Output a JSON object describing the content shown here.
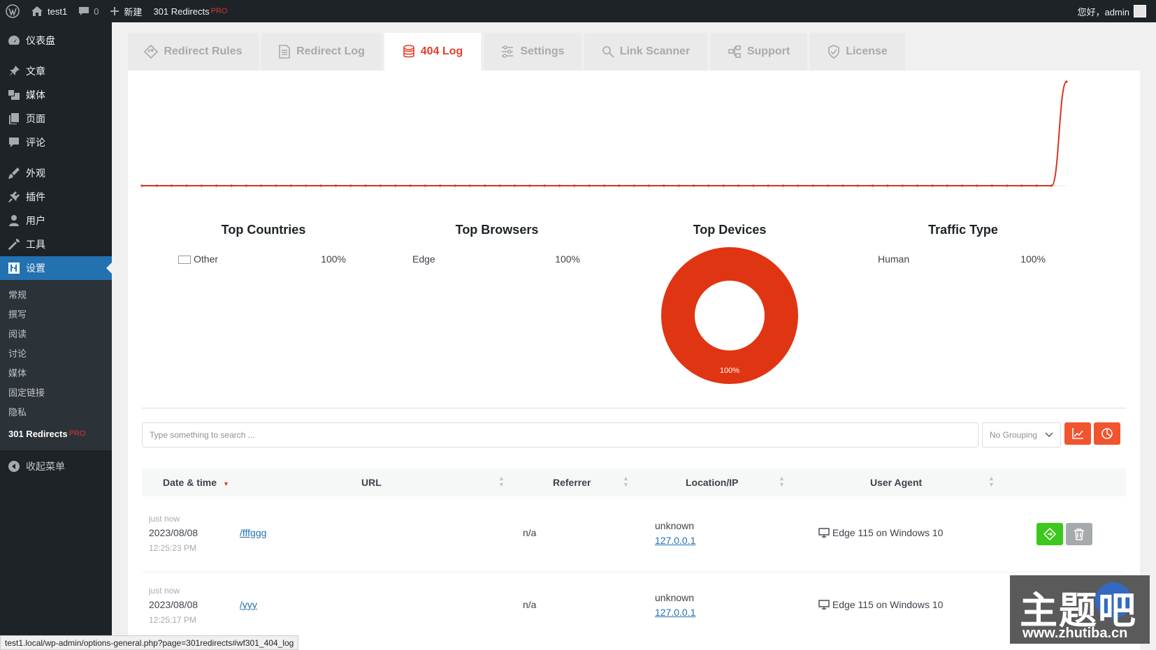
{
  "adminbar": {
    "site_name": "test1",
    "comments_count": "0",
    "new_label": "新建",
    "plugin_label": "301 Redirects",
    "pro_label": "PRO",
    "greeting": "您好，admin"
  },
  "sidebar": {
    "items": [
      {
        "label": "仪表盘",
        "icon": "dashboard-icon"
      },
      {
        "label": "文章",
        "icon": "pin-icon"
      },
      {
        "label": "媒体",
        "icon": "media-icon"
      },
      {
        "label": "页面",
        "icon": "page-icon"
      },
      {
        "label": "评论",
        "icon": "comment-icon"
      },
      {
        "label": "外观",
        "icon": "brush-icon"
      },
      {
        "label": "插件",
        "icon": "plugin-icon"
      },
      {
        "label": "用户",
        "icon": "user-icon"
      },
      {
        "label": "工具",
        "icon": "wrench-icon"
      },
      {
        "label": "设置",
        "icon": "settings-icon"
      }
    ],
    "submenu": [
      "常规",
      "撰写",
      "阅读",
      "讨论",
      "媒体",
      "固定链接",
      "隐私"
    ],
    "submenu_current": "301 Redirects",
    "submenu_pro": "PRO",
    "collapse_label": "收起菜单"
  },
  "tabs": [
    {
      "label": "Redirect Rules",
      "icon": "diamond-arrow-icon"
    },
    {
      "label": "Redirect Log",
      "icon": "document-icon"
    },
    {
      "label": "404 Log",
      "icon": "database-icon",
      "active": true
    },
    {
      "label": "Settings",
      "icon": "sliders-icon"
    },
    {
      "label": "Link Scanner",
      "icon": "search-icon"
    },
    {
      "label": "Support",
      "icon": "network-icon"
    },
    {
      "label": "License",
      "icon": "shield-check-icon"
    }
  ],
  "chart_data": [
    {
      "type": "line",
      "series": [
        {
          "values": [
            0,
            0,
            0,
            0,
            0,
            0,
            0,
            0,
            0,
            0,
            0,
            0,
            0,
            0,
            0,
            0,
            0,
            0,
            0,
            0,
            0,
            0,
            0,
            0,
            0,
            0,
            0,
            0,
            0,
            0,
            0,
            0,
            0,
            0,
            0,
            0,
            0,
            0,
            0,
            0,
            0,
            0,
            0,
            0,
            0,
            0,
            0,
            0,
            0,
            0,
            0,
            0,
            0,
            0,
            0,
            0,
            0,
            0,
            0,
            0,
            0,
            0,
            1
          ]
        }
      ],
      "color": "#d9341f",
      "grid": false
    },
    {
      "type": "pie",
      "title": "Top Devices",
      "slices": [
        {
          "label": "100%",
          "value": 100
        }
      ],
      "color": "#e03512"
    }
  ],
  "stats": {
    "countries": {
      "title": "Top Countries",
      "label": "Other",
      "value": "100%"
    },
    "browsers": {
      "title": "Top Browsers",
      "label": "Edge",
      "value": "100%"
    },
    "devices": {
      "title": "Top Devices",
      "value": "100%"
    },
    "traffic": {
      "title": "Traffic Type",
      "label": "Human",
      "value": "100%"
    }
  },
  "filters": {
    "search_placeholder": "Type something to search ...",
    "grouping": "No Grouping"
  },
  "table": {
    "headers": [
      "Date & time",
      "URL",
      "Referrer",
      "Location/IP",
      "User Agent"
    ],
    "rows": [
      {
        "ago": "just now",
        "date": "2023/08/08",
        "time": "12:25:23 PM",
        "url": "/fffggg",
        "referrer": "n/a",
        "location": "unknown",
        "ip": "127.0.0.1",
        "agent": "Edge 115 on Windows 10"
      },
      {
        "ago": "just now",
        "date": "2023/08/08",
        "time": "12:25:17 PM",
        "url": "/yyy",
        "referrer": "n/a",
        "location": "unknown",
        "ip": "127.0.0.1",
        "agent": "Edge 115 on Windows 10"
      }
    ]
  },
  "statusbar": "test1.local/wp-admin/options-general.php?page=301redirects#wf301_404_log",
  "watermark": {
    "big": "主题吧",
    "url": "www.zhutiba.cn"
  },
  "colors": {
    "accent": "#e53e2a",
    "wp_blue": "#2271b1",
    "green": "#3cc81e",
    "dark": "#1d2327"
  }
}
